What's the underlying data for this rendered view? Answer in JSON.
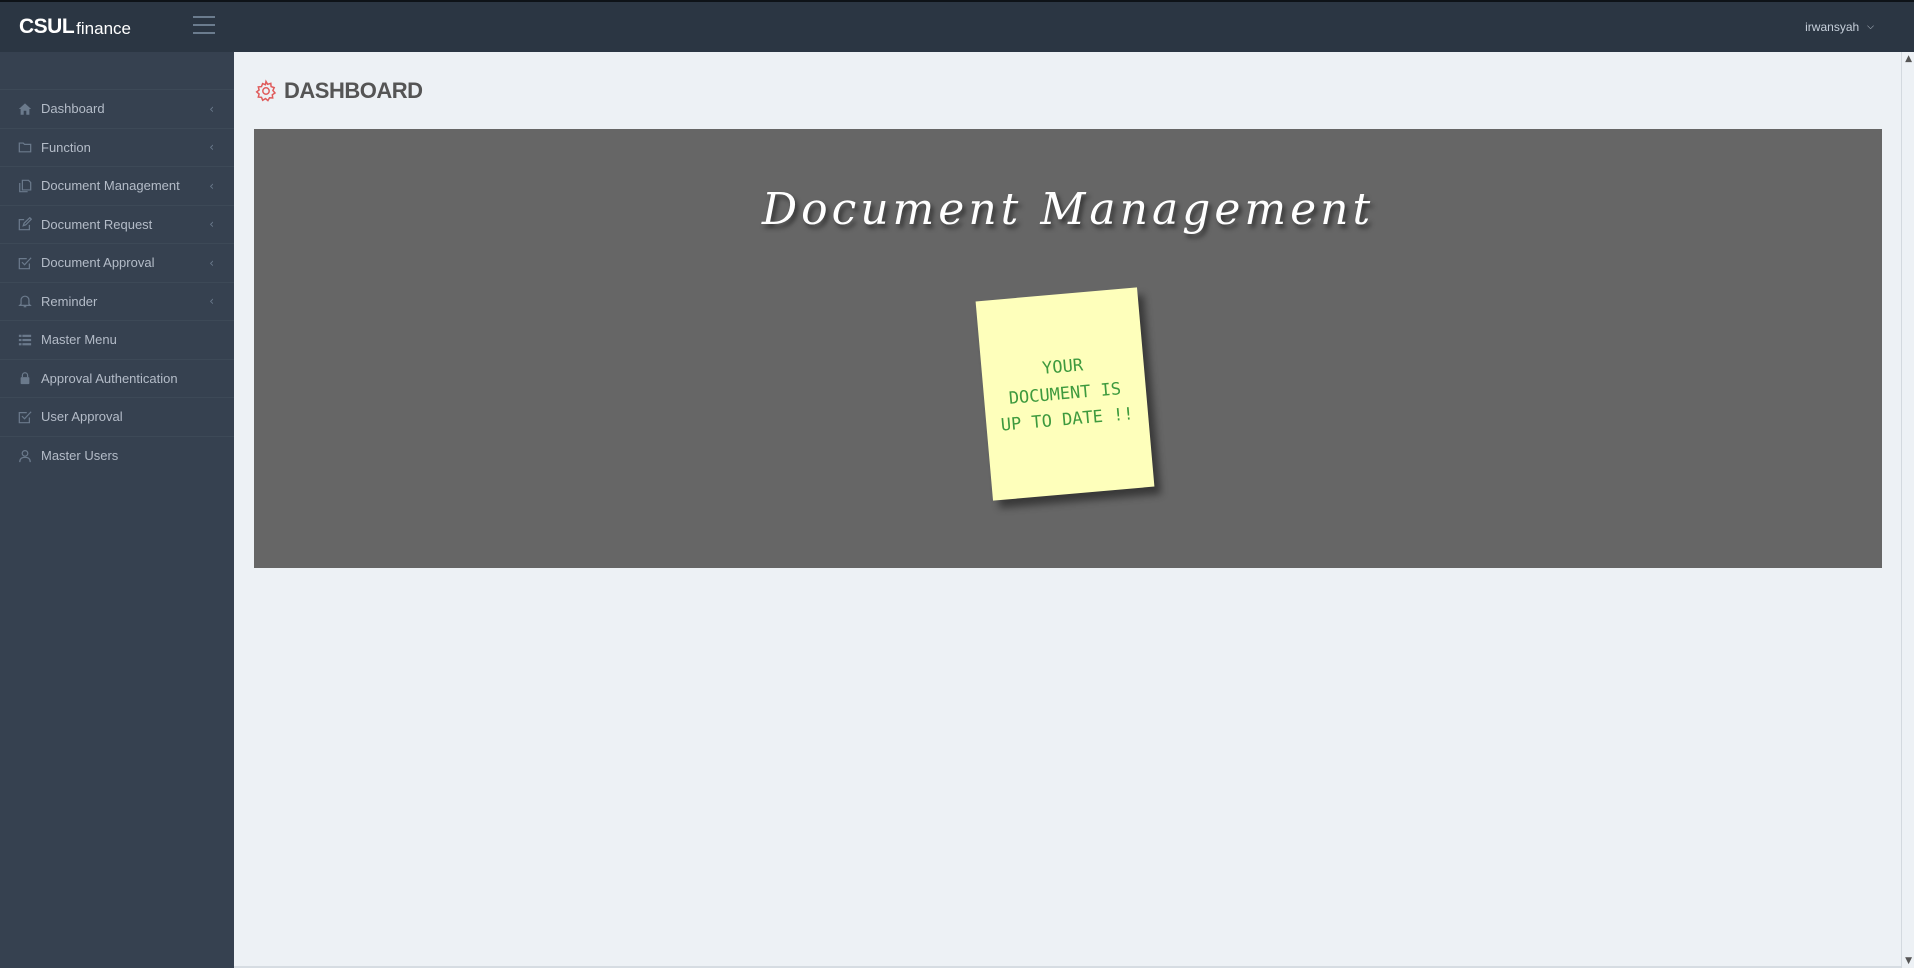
{
  "header": {
    "brand_strong": "CSUL",
    "brand_light": "finance",
    "user_name": "irwansyah"
  },
  "sidebar": {
    "items": [
      {
        "label": "Dashboard",
        "icon": "home-icon",
        "has_arrow": true
      },
      {
        "label": "Function",
        "icon": "folder-icon",
        "has_arrow": true
      },
      {
        "label": "Document Management",
        "icon": "documents-icon",
        "has_arrow": true
      },
      {
        "label": "Document Request",
        "icon": "edit-icon",
        "has_arrow": true
      },
      {
        "label": "Document Approval",
        "icon": "check-square-icon",
        "has_arrow": true
      },
      {
        "label": "Reminder",
        "icon": "bell-icon",
        "has_arrow": true
      },
      {
        "label": "Master Menu",
        "icon": "list-icon",
        "has_arrow": false
      },
      {
        "label": "Approval Authentication",
        "icon": "lock-icon",
        "has_arrow": false
      },
      {
        "label": "User Approval",
        "icon": "check-square-icon",
        "has_arrow": false
      },
      {
        "label": "Master Users",
        "icon": "user-icon",
        "has_arrow": false
      }
    ]
  },
  "main": {
    "title": "DASHBOARD",
    "banner_heading": "Document Management",
    "sticky_note": [
      "YOUR",
      "DOCUMENT IS",
      "UP TO DATE !!"
    ]
  },
  "colors": {
    "header_bg": "#2b3643",
    "sidebar_bg": "#364150",
    "content_bg": "#edf1f5",
    "banner_bg": "#666666",
    "title_icon": "#e05b5b",
    "note_bg": "#feffbb",
    "note_text": "#3e9a3e"
  }
}
